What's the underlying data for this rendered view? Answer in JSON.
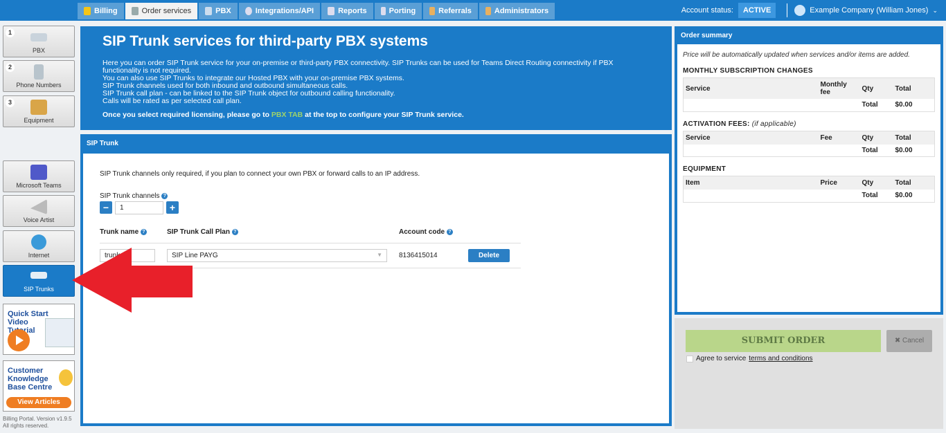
{
  "nav": {
    "tabs": [
      {
        "label": "Billing",
        "color": "#f5c518"
      },
      {
        "label": "Order services",
        "color": "#8aa"
      },
      {
        "label": "PBX",
        "color": "#cde"
      },
      {
        "label": "Integrations/API",
        "color": "#dde"
      },
      {
        "label": "Reports",
        "color": "#dde"
      },
      {
        "label": "Porting",
        "color": "#dde"
      },
      {
        "label": "Referrals",
        "color": "#e8b060"
      },
      {
        "label": "Administrators",
        "color": "#e8b060"
      }
    ],
    "active_tab": "Order services"
  },
  "account": {
    "status_label": "Account status:",
    "status": "ACTIVE",
    "user": "Example Company (William Jones)"
  },
  "sidebar": {
    "items": [
      {
        "num": "1",
        "label": "PBX"
      },
      {
        "num": "2",
        "label": "Phone Numbers"
      },
      {
        "num": "3",
        "label": "Equipment"
      },
      {
        "label": "Microsoft Teams"
      },
      {
        "label": "Voice Artist"
      },
      {
        "label": "Internet"
      },
      {
        "label": "SIP Trunks"
      }
    ],
    "active": "SIP Trunks",
    "banner1": "Quick Start Video Tutorial",
    "banner2": "Customer Knowledge Base Centre",
    "banner2_button": "View Articles",
    "footer1": "Billing Portal. Version v1.9.5",
    "footer2": "All rights reserved."
  },
  "intro": {
    "title": "SIP Trunk services for third-party PBX systems",
    "lines": [
      "Here you can order SIP Trunk service for your on-premise or third-party PBX connectivity. SIP Trunks can be used for Teams Direct Routing connectivity if PBX functionality is not required.",
      "You can also use SIP Trunks to integrate our Hosted PBX with your on-premise PBX systems.",
      "SIP Trunk channels used for both inbound and outbound simultaneous calls.",
      "SIP Trunk call plan - can be linked to the SIP Trunk object for outbound calling functionality.",
      "Calls will be rated as per selected call plan."
    ],
    "last_pre": "Once you select required licensing, please go to ",
    "last_link": "PBX TAB",
    "last_post": " at the top to configure your SIP Trunk service."
  },
  "sip": {
    "header": "SIP Trunk",
    "note": "SIP Trunk channels only required, if you plan to connect your own PBX or forward calls to an IP address.",
    "channels_label": "SIP Trunk channels",
    "channels_value": "1",
    "col_name": "Trunk name",
    "col_plan": "SIP Trunk Call Plan",
    "col_code": "Account code",
    "row": {
      "name": "trunk 1",
      "plan": "SIP Line PAYG",
      "code": "8136415014",
      "delete": "Delete"
    }
  },
  "summary": {
    "header": "Order summary",
    "note": "Price will be automatically updated when services and/or items are added.",
    "monthly": {
      "title": "MONTHLY SUBSCRIPTION CHANGES",
      "cols": [
        "Service",
        "Monthly fee",
        "Qty",
        "Total"
      ],
      "total_label": "Total",
      "total": "$0.00"
    },
    "activation": {
      "title": "ACTIVATION FEES:",
      "sub": "(if applicable)",
      "cols": [
        "Service",
        "Fee",
        "Qty",
        "Total"
      ],
      "total_label": "Total",
      "total": "$0.00"
    },
    "equipment": {
      "title": "EQUIPMENT",
      "cols": [
        "Item",
        "Price",
        "Qty",
        "Total"
      ],
      "total_label": "Total",
      "total": "$0.00"
    }
  },
  "actions": {
    "submit": "SUBMIT ORDER",
    "cancel": "Cancel",
    "agree": "Agree to service ",
    "terms": "terms and conditions"
  }
}
